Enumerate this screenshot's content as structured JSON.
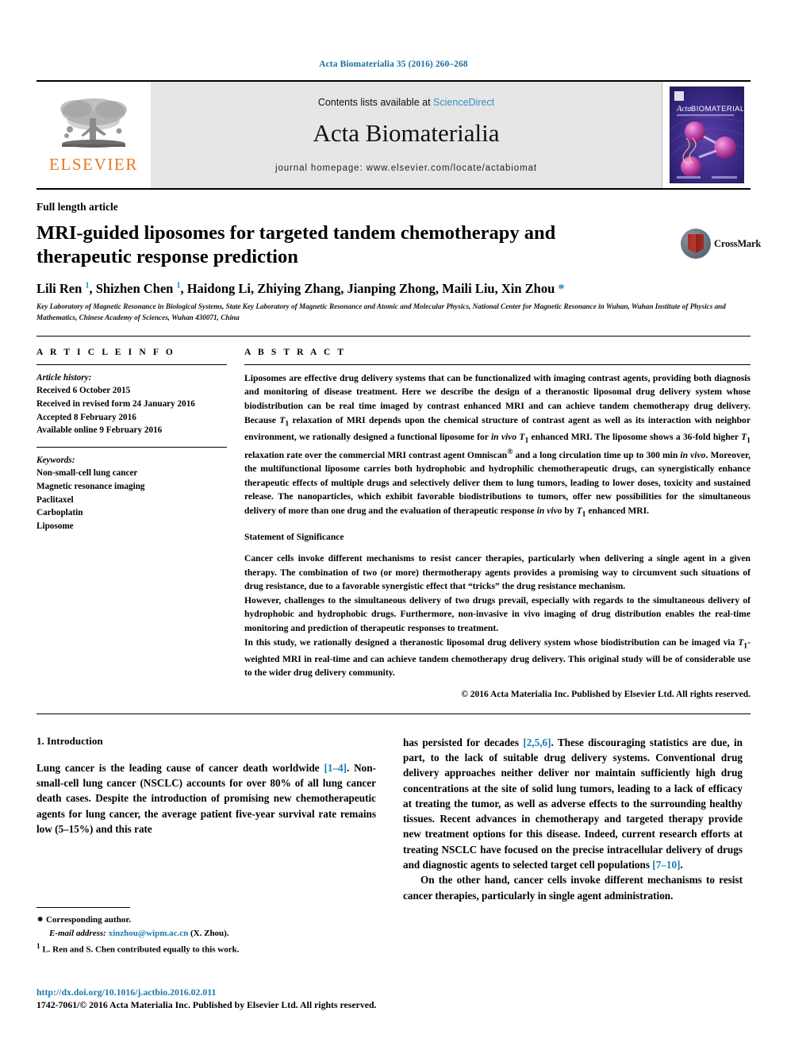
{
  "running_head": "Acta Biomaterialia 35 (2016) 260–268",
  "masthead": {
    "publisher_name": "ELSEVIER",
    "contents_prefix": "Contents lists available at",
    "contents_link": "ScienceDirect",
    "journal_title": "Acta Biomaterialia",
    "homepage": "journal homepage: www.elsevier.com/locate/actabiomat",
    "cover_title_1": "Acta",
    "cover_title_2": "BIOMATERIALIA"
  },
  "article": {
    "type": "Full length article",
    "title": "MRI-guided liposomes for targeted tandem chemotherapy and therapeutic response prediction",
    "crossmark_label": "CrossMark",
    "authors_html": "Lili Ren <sup>1</sup>, Shizhen Chen <sup>1</sup>, Haidong Li, Zhiying Zhang, Jianping Zhong, Maili Liu, Xin Zhou <span class=\"star\">*</span>",
    "affiliation": "Key Laboratory of Magnetic Resonance in Biological Systems, State Key Laboratory of Magnetic Resonance and Atomic and Molecular Physics, National Center for Magnetic Resonance in Wuhan, Wuhan Institute of Physics and Mathematics, Chinese Academy of Sciences, Wuhan 430071, China"
  },
  "article_info": {
    "heading": "A R T I C L E   I N F O",
    "history_label": "Article history:",
    "history": [
      "Received 6 October 2015",
      "Received in revised form 24 January 2016",
      "Accepted 8 February 2016",
      "Available online 9 February 2016"
    ],
    "keywords_label": "Keywords:",
    "keywords": [
      "Non-small-cell lung cancer",
      "Magnetic resonance imaging",
      "Paclitaxel",
      "Carboplatin",
      "Liposome"
    ]
  },
  "abstract": {
    "heading": "A B S T R A C T",
    "text_html": "Liposomes are effective drug delivery systems that can be functionalized with imaging contrast agents, providing both diagnosis and monitoring of disease treatment. Here we describe the design of a theranostic liposomal drug delivery system whose biodistribution can be real time imaged by contrast enhanced MRI and can achieve tandem chemotherapy drug delivery. Because <span class=\"it\">T</span><sub>1</sub> relaxation of MRI depends upon the chemical structure of contrast agent as well as its interaction with neighbor environment, we rationally designed a functional liposome for <span class=\"it\">in vivo</span> <span class=\"it\">T</span><sub>1</sub> enhanced MRI. The liposome shows a 36-fold higher <span class=\"it\">T</span><sub>1</sub> relaxation rate over the commercial MRI contrast agent Omniscan<sup>®</sup> and a long circulation time up to 300 min <span class=\"it\">in vivo</span>. Moreover, the multifunctional liposome carries both hydrophobic and hydrophilic chemotherapeutic drugs, can synergistically enhance therapeutic effects of multiple drugs and selectively deliver them to lung tumors, leading to lower doses, toxicity and sustained release. The nanoparticles, which exhibit favorable biodistributions to tumors, offer new possibilities for the simultaneous delivery of more than one drug and the evaluation of therapeutic response <span class=\"it\">in vivo</span> by <span class=\"it\">T</span><sub>1</sub> enhanced MRI.",
    "significance_heading": "Statement of Significance",
    "significance_paragraphs_html": [
      "Cancer cells invoke different mechanisms to resist cancer therapies, particularly when delivering a single agent in a given therapy. The combination of two (or more) thermotherapy agents provides a promising way to circumvent such situations of drug resistance, due to a favorable synergistic effect that “tricks” the drug resistance mechanism.",
      "However, challenges to the simultaneous delivery of two drugs prevail, especially with regards to the simultaneous delivery of hydrophobic and hydrophobic drugs. Furthermore, non-invasive in vivo imaging of drug distribution enables the real-time monitoring and prediction of therapeutic responses to treatment.",
      "In this study, we rationally designed a theranostic liposomal drug delivery system whose biodistribution can be imaged via <span class=\"it\">T</span><sub>1</sub>-weighted MRI in real-time and can achieve tandem chemotherapy drug delivery. This original study will be of considerable use to the wider drug delivery community."
    ],
    "copyright": "© 2016 Acta Materialia Inc. Published by Elsevier Ltd. All rights reserved."
  },
  "body": {
    "section_heading": "1. Introduction",
    "left_column_html": "<span class=\"indent\"></span>Lung cancer is the leading cause of cancer death worldwide <span class=\"ref\">[1–4]</span>. Non-small-cell lung cancer (NSCLC) accounts for over 80% of all lung cancer death cases. Despite the introduction of promising new chemotherapeutic agents for lung cancer, the average patient five-year survival rate remains low (5–15%) and this rate",
    "right_column_paragraph_1_html": "has persisted for decades <span class=\"ref\">[2,5,6]</span>. These discouraging statistics are due, in part, to the lack of suitable drug delivery systems. Conventional drug delivery approaches neither deliver nor maintain sufficiently high drug concentrations at the site of solid lung tumors, leading to a lack of efficacy at treating the tumor, as well as adverse effects to the surrounding healthy tissues. Recent advances in chemotherapy and targeted therapy provide new treatment options for this disease. Indeed, current research efforts at treating NSCLC have focused on the precise intracellular delivery of drugs and diagnostic agents to selected target cell populations <span class=\"ref\">[7–10]</span>.",
    "right_column_paragraph_2_html": "On the other hand, cancer cells invoke different mechanisms to resist cancer therapies, particularly in single agent administration."
  },
  "footnotes": {
    "corresponding_mark": "⁕",
    "corresponding_text": "Corresponding author.",
    "email_label": "E-mail address:",
    "email": "xinzhou@wipm.ac.cn",
    "email_suffix": "(X. Zhou).",
    "equal_mark": "1",
    "equal_text": "L. Ren and S. Chen contributed equally to this work."
  },
  "colophon": {
    "doi": "http://dx.doi.org/10.1016/j.actbio.2016.02.011",
    "issn_line": "1742-7061/© 2016 Acta Materialia Inc. Published by Elsevier Ltd. All rights reserved."
  },
  "colors": {
    "link_blue": "#1a7aad",
    "elsevier_orange": "#E87722",
    "sciencedirect_blue": "#3c8dc5"
  }
}
